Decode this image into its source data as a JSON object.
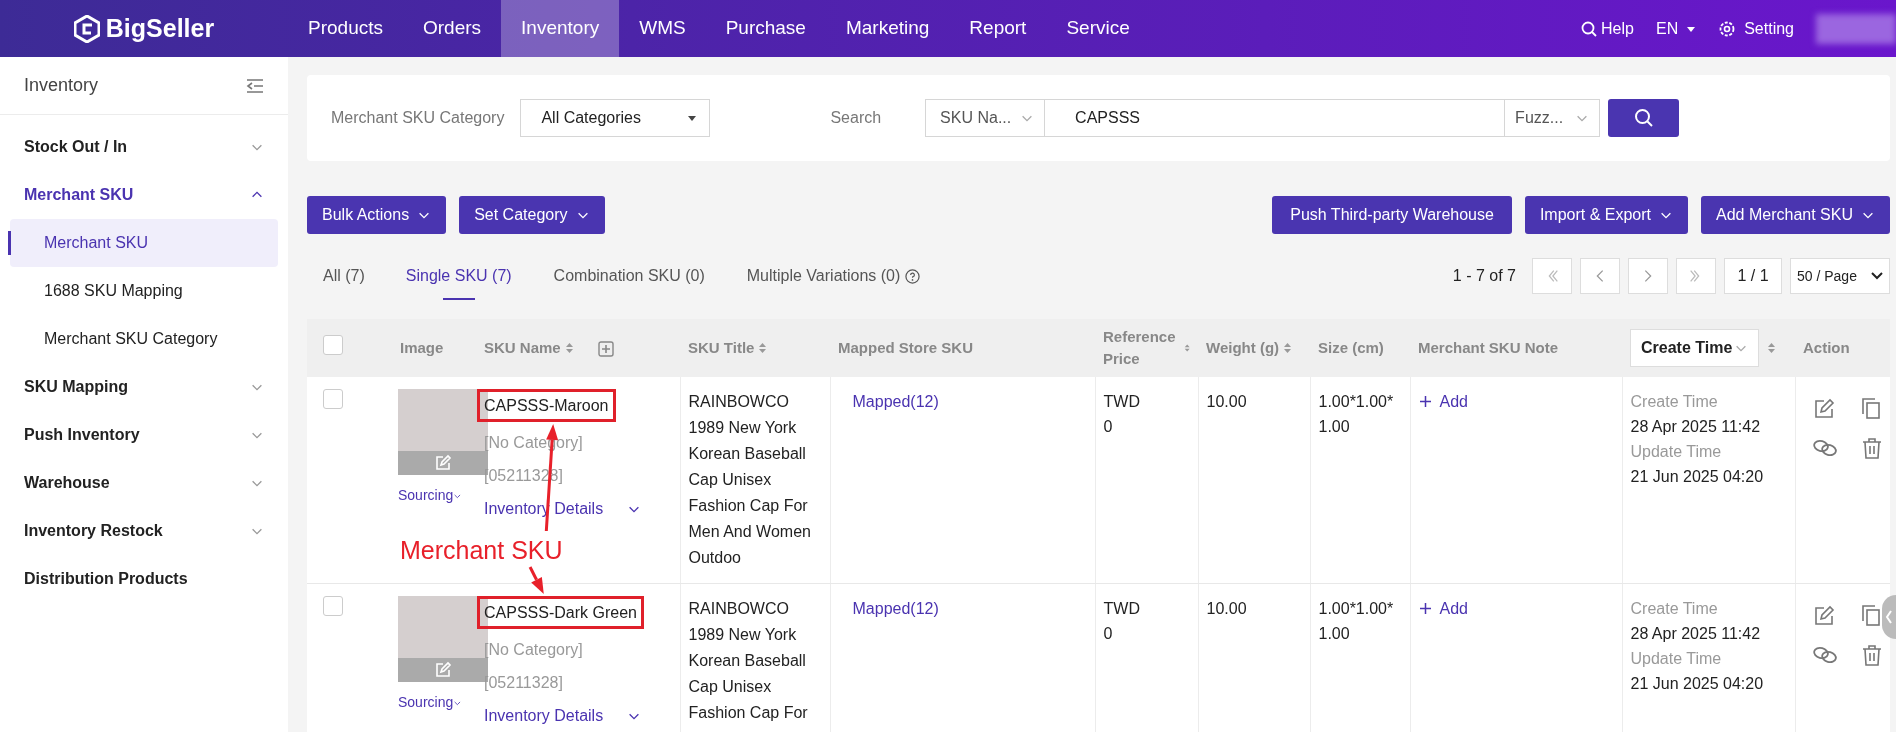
{
  "topbar": {
    "logo": "BigSeller",
    "menu": [
      {
        "label": "Products",
        "selected": false
      },
      {
        "label": "Orders",
        "selected": false
      },
      {
        "label": "Inventory",
        "selected": true
      },
      {
        "label": "WMS",
        "selected": false
      },
      {
        "label": "Purchase",
        "selected": false
      },
      {
        "label": "Marketing",
        "selected": false
      },
      {
        "label": "Report",
        "selected": false
      },
      {
        "label": "Service",
        "selected": false
      }
    ],
    "help": "Help",
    "language": "EN",
    "setting": "Setting"
  },
  "sidebar": {
    "title": "Inventory",
    "items": [
      {
        "label": "Stock Out / In",
        "kind": "group",
        "expanded": false
      },
      {
        "label": "Merchant SKU",
        "kind": "group",
        "expanded": true,
        "children": [
          {
            "label": "Merchant SKU",
            "selected": true
          },
          {
            "label": "1688 SKU Mapping",
            "selected": false
          },
          {
            "label": "Merchant SKU Category",
            "selected": false
          }
        ]
      },
      {
        "label": "SKU Mapping",
        "kind": "group",
        "expanded": false
      },
      {
        "label": "Push Inventory",
        "kind": "group",
        "expanded": false
      },
      {
        "label": "Warehouse",
        "kind": "group",
        "expanded": false
      },
      {
        "label": "Inventory Restock",
        "kind": "group",
        "expanded": false
      },
      {
        "label": "Distribution Products",
        "kind": "link"
      }
    ]
  },
  "filter": {
    "category_label": "Merchant SKU Category",
    "category_value": "All Categories",
    "search_label": "Search",
    "search_field": "SKU Na...",
    "search_value": "CAPSSS",
    "match_mode": "Fuzz..."
  },
  "actions_left": [
    "Bulk Actions",
    "Set Category"
  ],
  "actions_right": [
    "Push Third-party Warehouse",
    "Import & Export",
    "Add Merchant SKU"
  ],
  "tabs": [
    {
      "label": "All (7)",
      "selected": false
    },
    {
      "label": "Single SKU (7)",
      "selected": true
    },
    {
      "label": "Combination SKU (0)",
      "selected": false
    },
    {
      "label": "Multiple Variations (0)",
      "selected": false,
      "help": true
    }
  ],
  "pagination": {
    "range": "1 - 7 of 7",
    "page": "1 / 1",
    "page_size": "50 / Page"
  },
  "table": {
    "select_all_checked": false,
    "columns": [
      {
        "label": "Image",
        "sortable": false
      },
      {
        "label": "SKU Name",
        "sortable": true
      },
      {
        "label": "SKU Title",
        "sortable": true
      },
      {
        "label": "Mapped Store SKU",
        "sortable": false
      },
      {
        "label": "Reference Price",
        "sortable": true
      },
      {
        "label": "Weight (g)",
        "sortable": true
      },
      {
        "label": "Size (cm)",
        "sortable": false
      },
      {
        "label": "Merchant SKU Note",
        "sortable": false
      },
      {
        "label": "Create Time",
        "sortable": true
      },
      {
        "label": "Action",
        "sortable": false
      }
    ],
    "rows": [
      {
        "checked": false,
        "highlighted": true,
        "sourcing": "Sourcing",
        "sku_name": "CAPSSS-Maroon",
        "category": "[No Category]",
        "code": "[05211328]",
        "details": "Inventory Details",
        "title": "RAINBOWCO 1989 New York Korean Baseball Cap Unisex Fashion Cap For Men And Women Outdoo",
        "mapped": "Mapped(12)",
        "currency": "TWD",
        "price": "0",
        "weight": "10.00",
        "size": "1.00*1.00*1.00",
        "note": "Add",
        "create_label": "Create Time",
        "create_time": "28 Apr 2025 11:42",
        "update_label": "Update Time",
        "update_time": "21 Jun 2025 04:20"
      },
      {
        "checked": false,
        "highlighted": true,
        "sourcing": "Sourcing",
        "sku_name": "CAPSSS-Dark Green",
        "category": "[No Category]",
        "code": "[05211328]",
        "details": "Inventory Details",
        "title": "RAINBOWCO 1989 New York Korean Baseball Cap Unisex Fashion Cap For",
        "mapped": "Mapped(12)",
        "currency": "TWD",
        "price": "0",
        "weight": "10.00",
        "size": "1.00*1.00*1.00",
        "note": "Add",
        "create_label": "Create Time",
        "create_time": "28 Apr 2025 11:42",
        "update_label": "Update Time",
        "update_time": "21 Jun 2025 04:20"
      }
    ]
  },
  "annotation": {
    "label": "Merchant SKU"
  }
}
